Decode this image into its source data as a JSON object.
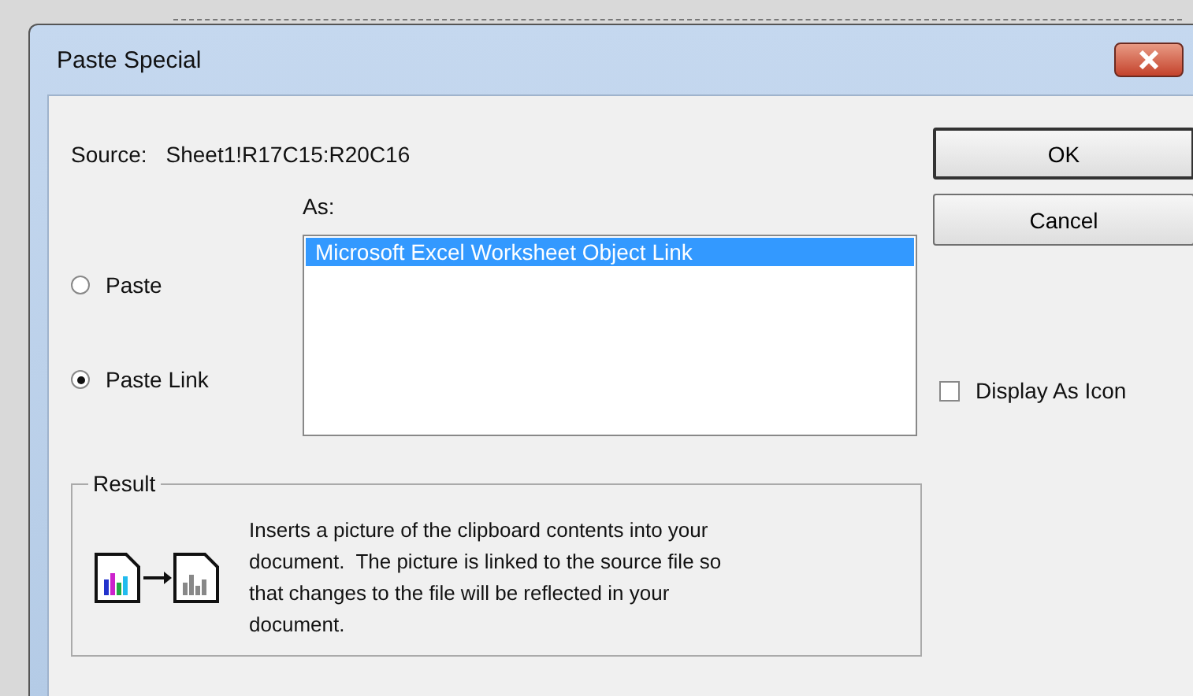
{
  "window": {
    "title": "Paste Special"
  },
  "source": {
    "label": "Source:",
    "value": "Sheet1!R17C15:R20C16"
  },
  "as_label": "As:",
  "options": [
    {
      "label": "Paste",
      "selected": false
    },
    {
      "label": "Paste Link",
      "selected": true
    }
  ],
  "formats": [
    {
      "label": "Microsoft Excel Worksheet Object Link",
      "selected": true
    }
  ],
  "buttons": [
    {
      "label": "OK",
      "default": true
    },
    {
      "label": "Cancel",
      "default": false
    }
  ],
  "display_as_icon": {
    "label": "Display As Icon",
    "checked": false
  },
  "result": {
    "title": "Result",
    "text": "Inserts a picture of the clipboard contents into your document.  The picture is linked to the source file so that changes to the file will be reflected in your document."
  }
}
